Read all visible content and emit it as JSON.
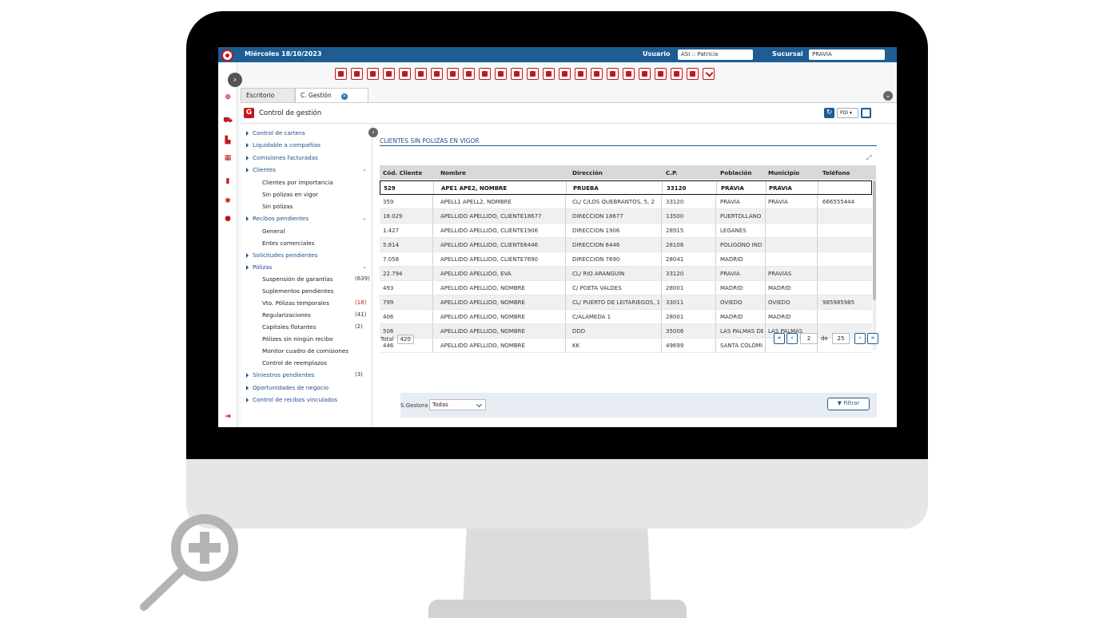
{
  "header": {
    "date": "Miércoles 18/10/2023",
    "user_label": "Usuario",
    "user_value": "ASI :: Patricia",
    "branch_label": "Sucursal",
    "branch_value": "PRAVIA"
  },
  "tabs": [
    {
      "label": "Escritorio"
    },
    {
      "label": "C. Gestión"
    }
  ],
  "panel": {
    "title": "Control de gestión",
    "icon_letter": "G",
    "format_select": "PDI",
    "tree_collapse_glyph": "‹"
  },
  "tree": [
    {
      "label": "Control de cartera",
      "level": 1
    },
    {
      "label": "Liquidable a compañías",
      "level": 1
    },
    {
      "label": "Comisiones facturadas",
      "level": 1
    },
    {
      "label": "Clientes",
      "level": 1,
      "expanded": true
    },
    {
      "label": "Clientes por importancia",
      "level": 2
    },
    {
      "label": "Sin pólizas en vigor",
      "level": 2
    },
    {
      "label": "Sin pólizas",
      "level": 2
    },
    {
      "label": "Recibos pendientes",
      "level": 1,
      "expanded": true
    },
    {
      "label": "General",
      "level": 2
    },
    {
      "label": "Entes comerciales",
      "level": 2
    },
    {
      "label": "Solicitudes pendientes",
      "level": 1
    },
    {
      "label": "Pólizas",
      "level": 1,
      "expanded": true
    },
    {
      "label": "Suspensión de garantías",
      "level": 2,
      "count": "(639)"
    },
    {
      "label": "Suplementos pendientes",
      "level": 2
    },
    {
      "label": "Vto. Pólizas temporales",
      "level": 2,
      "count": "(18)",
      "count_red": true
    },
    {
      "label": "Regularizaciones",
      "level": 2,
      "count": "(41)"
    },
    {
      "label": "Capitales flotantes",
      "level": 2,
      "count": "(2)"
    },
    {
      "label": "Pólizes sin ningún recibo",
      "level": 2
    },
    {
      "label": "Monitor cuadro de comisiones",
      "level": 2
    },
    {
      "label": "Control de reemplazos",
      "level": 2
    },
    {
      "label": "Siniestros pendientes",
      "level": 1,
      "count": "(3)"
    },
    {
      "label": "Oportunidades de negocio",
      "level": 1
    },
    {
      "label": "Control de recibos vinculados",
      "level": 1
    }
  ],
  "report": {
    "title": "CLIENTES SIN PÓLIZAS EN VIGOR",
    "columns": [
      "Cód. Cliente",
      "Nombre",
      "Dirección",
      "C.P.",
      "Población",
      "Municipio",
      "Teléfono"
    ],
    "rows": [
      [
        "529",
        "APE1 APE2, NOMBRE",
        "PRUEBA",
        "33120",
        "PRAVIA",
        "PRAVIA",
        ""
      ],
      [
        "359",
        "APELL1 APELL2, NOMBRE",
        "CL/ C/LOS QUEBRANTOS, 5, 2",
        "33120",
        "PRAVIA",
        "PRAVIA",
        "666555444"
      ],
      [
        "18.029",
        "APELLIDO APELLIDO, CLIENTE18677",
        "DIRECCION 18677",
        "13500",
        "PUERTOLLANO",
        "",
        ""
      ],
      [
        "1.427",
        "APELLIDO APELLIDO, CLIENTE1906",
        "DIRECCION 1906",
        "28915",
        "LEGANES",
        "",
        ""
      ],
      [
        "5.814",
        "APELLIDO APELLIDO, CLIENTE6446",
        "DIRECCION 6446",
        "28108",
        "POLIGONO IND",
        "",
        ""
      ],
      [
        "7.058",
        "APELLIDO APELLIDO, CLIENTE7690",
        "DIRECCION 7690",
        "28041",
        "MADRID",
        "",
        ""
      ],
      [
        "22.794",
        "APELLIDO APELLIDO, EVA",
        "CL/ RIO ARANGUIN",
        "33120",
        "PRAVIA",
        "PRAVIAS",
        ""
      ],
      [
        "493",
        "APELLIDO APELLIDO, NOMBRE",
        "C/ POETA VALDES",
        "28001",
        "MADRID",
        "MADRID",
        ""
      ],
      [
        "799",
        "APELLIDO APELLIDO, NOMBRE",
        "CL/ PUERTO DE LEITARIEGOS, 1",
        "33011",
        "OVIEDO",
        "OVIEDO",
        "985985985"
      ],
      [
        "406",
        "APELLIDO APELLIDO, NOMBRE",
        "C/ALAMEDA 1",
        "28001",
        "MADRID",
        "MADRID",
        ""
      ],
      [
        "506",
        "APELLIDO APELLIDO, NOMBRE",
        "DDD",
        "35006",
        "LAS PALMAS DE",
        "LAS PALMAS",
        ""
      ],
      [
        "446",
        "APELLIDO APELLIDO, NOMBRE",
        "KK",
        "49699",
        "SANTA COLOMI",
        "",
        ""
      ]
    ],
    "total_label": "Total",
    "total_value": "420",
    "pager": {
      "first": "«",
      "prev": "‹",
      "current": "2",
      "of_label": "de",
      "pages": "25",
      "next": "›",
      "last": "»"
    }
  },
  "filter": {
    "label": "S.Gestora",
    "value": "Todas",
    "button": "Filtrar"
  },
  "colors": {
    "brand_red": "#c4161c",
    "header_blue": "#1d5d94"
  }
}
